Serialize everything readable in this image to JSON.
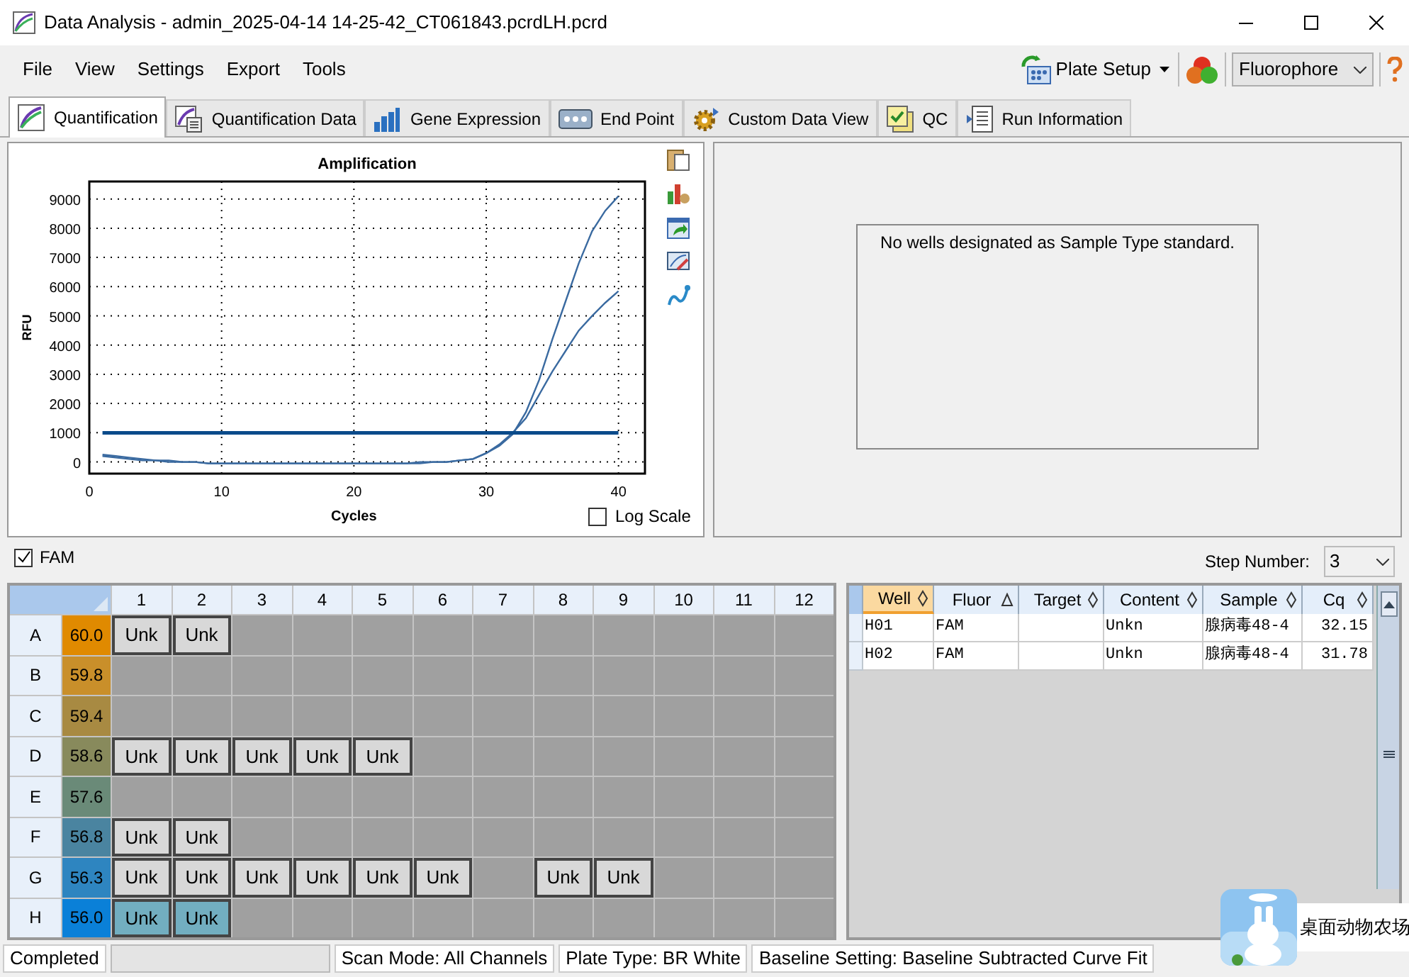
{
  "window": {
    "title": "Data Analysis - admin_2025-04-14 14-25-42_CT061843.pcrdLH.pcrd"
  },
  "menu": [
    "File",
    "View",
    "Settings",
    "Export",
    "Tools"
  ],
  "toolbar": {
    "plate_setup": "Plate Setup",
    "fluorophore": "Fluorophore"
  },
  "tabs": [
    {
      "label": "Quantification",
      "selected": true
    },
    {
      "label": "Quantification Data",
      "selected": false
    },
    {
      "label": "Gene Expression",
      "selected": false
    },
    {
      "label": "End Point",
      "selected": false
    },
    {
      "label": "Custom Data View",
      "selected": false
    },
    {
      "label": "QC",
      "selected": false
    },
    {
      "label": "Run Information",
      "selected": false
    }
  ],
  "chart": {
    "log_scale": {
      "label": "Log Scale",
      "checked": false
    },
    "chart_data": {
      "type": "line",
      "title": "Amplification",
      "xlabel": "Cycles",
      "ylabel": "RFU",
      "grid": true,
      "xlim": [
        0,
        42
      ],
      "ylim": [
        -400,
        9600
      ],
      "xticks": [
        0,
        10,
        20,
        30,
        40
      ],
      "yticks": [
        0,
        1000,
        2000,
        3000,
        4000,
        5000,
        6000,
        7000,
        8000,
        9000
      ],
      "x": [
        1,
        2,
        3,
        4,
        5,
        6,
        7,
        8,
        9,
        10,
        11,
        12,
        13,
        14,
        15,
        16,
        17,
        18,
        19,
        20,
        21,
        22,
        23,
        24,
        25,
        26,
        27,
        28,
        29,
        30,
        31,
        32,
        33,
        34,
        35,
        36,
        37,
        38,
        39,
        40
      ],
      "series": [
        {
          "color": "#3a6aa0",
          "values": [
            250,
            200,
            150,
            100,
            50,
            50,
            0,
            0,
            -50,
            -50,
            -50,
            -50,
            -50,
            -50,
            -50,
            -50,
            -50,
            -50,
            -50,
            -50,
            -50,
            -50,
            -50,
            -50,
            -50,
            0,
            0,
            50,
            100,
            300,
            550,
            950,
            1700,
            2800,
            4200,
            5500,
            6800,
            7900,
            8600,
            9100
          ]
        },
        {
          "color": "#3a6aa0",
          "values": [
            200,
            150,
            100,
            50,
            50,
            0,
            0,
            0,
            -50,
            -50,
            -50,
            -50,
            -50,
            -50,
            -50,
            -50,
            -50,
            -50,
            -50,
            -50,
            -50,
            -50,
            -50,
            -50,
            0,
            0,
            0,
            50,
            100,
            300,
            600,
            1000,
            1500,
            2300,
            3100,
            3800,
            4500,
            5000,
            5450,
            5850
          ]
        },
        {
          "color": "#0a4a8a",
          "values": [
            1000,
            1000,
            1000,
            1000,
            1000,
            1000,
            1000,
            1000,
            1000,
            1000,
            1000,
            1000,
            1000,
            1000,
            1000,
            1000,
            1000,
            1000,
            1000,
            1000,
            1000,
            1000,
            1000,
            1000,
            1000,
            1000,
            1000,
            1000,
            1000,
            1000,
            1000,
            1000,
            1000,
            1000,
            1000,
            1000,
            1000,
            1000,
            1000,
            1000
          ]
        }
      ]
    }
  },
  "standard_curve": {
    "message": "No wells designated as Sample Type standard."
  },
  "fluor_filter": {
    "label": "FAM",
    "checked": true
  },
  "step": {
    "label": "Step Number:",
    "value": "3"
  },
  "plate": {
    "columns": [
      "1",
      "2",
      "3",
      "4",
      "5",
      "6",
      "7",
      "8",
      "9",
      "10",
      "11",
      "12"
    ],
    "rows": [
      {
        "label": "A",
        "temperature": "60.0",
        "color": "#e08a00",
        "wells": [
          {
            "kind": "sample",
            "text": "Unk",
            "selected": false
          },
          {
            "kind": "sample",
            "text": "Unk",
            "selected": false
          },
          {
            "kind": "empty"
          },
          {
            "kind": "empty"
          },
          {
            "kind": "empty"
          },
          {
            "kind": "empty"
          },
          {
            "kind": "empty"
          },
          {
            "kind": "empty"
          },
          {
            "kind": "empty"
          },
          {
            "kind": "empty"
          },
          {
            "kind": "empty"
          },
          {
            "kind": "empty"
          }
        ]
      },
      {
        "label": "B",
        "temperature": "59.8",
        "color": "#c98f2a",
        "wells": [
          {
            "kind": "empty"
          },
          {
            "kind": "empty"
          },
          {
            "kind": "empty"
          },
          {
            "kind": "empty"
          },
          {
            "kind": "empty"
          },
          {
            "kind": "empty"
          },
          {
            "kind": "empty"
          },
          {
            "kind": "empty"
          },
          {
            "kind": "empty"
          },
          {
            "kind": "empty"
          },
          {
            "kind": "empty"
          },
          {
            "kind": "empty"
          }
        ]
      },
      {
        "label": "C",
        "temperature": "59.4",
        "color": "#a88a42",
        "wells": [
          {
            "kind": "empty"
          },
          {
            "kind": "empty"
          },
          {
            "kind": "empty"
          },
          {
            "kind": "empty"
          },
          {
            "kind": "empty"
          },
          {
            "kind": "empty"
          },
          {
            "kind": "empty"
          },
          {
            "kind": "empty"
          },
          {
            "kind": "empty"
          },
          {
            "kind": "empty"
          },
          {
            "kind": "empty"
          },
          {
            "kind": "empty"
          }
        ]
      },
      {
        "label": "D",
        "temperature": "58.6",
        "color": "#888a5c",
        "wells": [
          {
            "kind": "sample",
            "text": "Unk",
            "selected": false
          },
          {
            "kind": "sample",
            "text": "Unk",
            "selected": false
          },
          {
            "kind": "sample",
            "text": "Unk",
            "selected": false
          },
          {
            "kind": "sample",
            "text": "Unk",
            "selected": false
          },
          {
            "kind": "sample",
            "text": "Unk",
            "selected": false
          },
          {
            "kind": "empty"
          },
          {
            "kind": "empty"
          },
          {
            "kind": "empty"
          },
          {
            "kind": "empty"
          },
          {
            "kind": "empty"
          },
          {
            "kind": "empty"
          },
          {
            "kind": "empty"
          }
        ]
      },
      {
        "label": "E",
        "temperature": "57.6",
        "color": "#6a8a78",
        "wells": [
          {
            "kind": "empty"
          },
          {
            "kind": "empty"
          },
          {
            "kind": "empty"
          },
          {
            "kind": "empty"
          },
          {
            "kind": "empty"
          },
          {
            "kind": "empty"
          },
          {
            "kind": "empty"
          },
          {
            "kind": "empty"
          },
          {
            "kind": "empty"
          },
          {
            "kind": "empty"
          },
          {
            "kind": "empty"
          },
          {
            "kind": "empty"
          }
        ]
      },
      {
        "label": "F",
        "temperature": "56.8",
        "color": "#4a84a0",
        "wells": [
          {
            "kind": "sample",
            "text": "Unk",
            "selected": false
          },
          {
            "kind": "sample",
            "text": "Unk",
            "selected": false
          },
          {
            "kind": "empty"
          },
          {
            "kind": "empty"
          },
          {
            "kind": "empty"
          },
          {
            "kind": "empty"
          },
          {
            "kind": "empty"
          },
          {
            "kind": "empty"
          },
          {
            "kind": "empty"
          },
          {
            "kind": "empty"
          },
          {
            "kind": "empty"
          },
          {
            "kind": "empty"
          }
        ]
      },
      {
        "label": "G",
        "temperature": "56.3",
        "color": "#2e85c0",
        "wells": [
          {
            "kind": "sample",
            "text": "Unk",
            "selected": false
          },
          {
            "kind": "sample",
            "text": "Unk",
            "selected": false
          },
          {
            "kind": "sample",
            "text": "Unk",
            "selected": false
          },
          {
            "kind": "sample",
            "text": "Unk",
            "selected": false
          },
          {
            "kind": "sample",
            "text": "Unk",
            "selected": false
          },
          {
            "kind": "sample",
            "text": "Unk",
            "selected": false
          },
          {
            "kind": "empty"
          },
          {
            "kind": "sample",
            "text": "Unk",
            "selected": false
          },
          {
            "kind": "sample",
            "text": "Unk",
            "selected": false
          },
          {
            "kind": "empty"
          },
          {
            "kind": "empty"
          },
          {
            "kind": "empty"
          }
        ]
      },
      {
        "label": "H",
        "temperature": "56.0",
        "color": "#0a80d8",
        "wells": [
          {
            "kind": "sample",
            "text": "Unk",
            "selected": true
          },
          {
            "kind": "sample",
            "text": "Unk",
            "selected": true
          },
          {
            "kind": "empty"
          },
          {
            "kind": "empty"
          },
          {
            "kind": "empty"
          },
          {
            "kind": "empty"
          },
          {
            "kind": "empty"
          },
          {
            "kind": "empty"
          },
          {
            "kind": "empty"
          },
          {
            "kind": "empty"
          },
          {
            "kind": "empty"
          },
          {
            "kind": "empty"
          }
        ]
      }
    ]
  },
  "results": {
    "columns": [
      {
        "label": "Well",
        "sorted": false,
        "selected": true
      },
      {
        "label": "Fluor",
        "sorted": true,
        "selected": false
      },
      {
        "label": "Target",
        "sorted": false,
        "selected": false
      },
      {
        "label": "Content",
        "sorted": false,
        "selected": false
      },
      {
        "label": "Sample",
        "sorted": false,
        "selected": false
      },
      {
        "label": "Cq",
        "sorted": false,
        "selected": false
      }
    ],
    "rows": [
      {
        "well": "H01",
        "fluor": "FAM",
        "content": "Unkn",
        "sample": "腺病毒48-4",
        "cq": "32.15"
      },
      {
        "well": "H02",
        "fluor": "FAM",
        "content": "Unkn",
        "sample": "腺病毒48-4",
        "cq": "31.78"
      }
    ]
  },
  "status_bar": {
    "state": "Completed",
    "progress": {
      "level": 0
    },
    "scan_mode": "Scan Mode: All Channels",
    "plate_type": "Plate Type: BR White",
    "baseline": "Baseline Setting: Baseline Subtracted Curve Fit"
  },
  "desktop_pet": {
    "label": "桌面动物农场"
  }
}
